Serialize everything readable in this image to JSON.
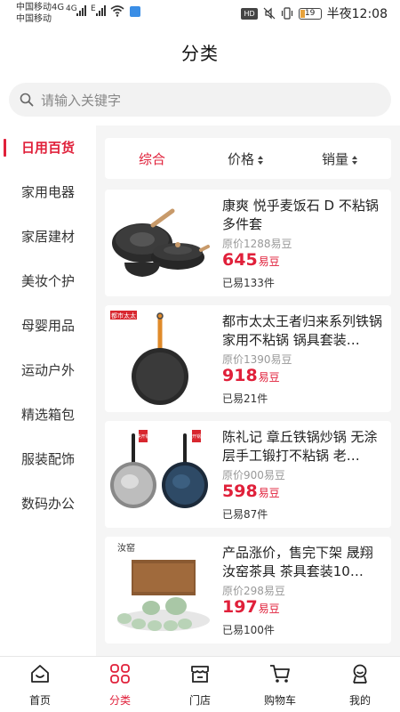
{
  "status_bar": {
    "carrier1": "中国移动4G",
    "carrier2": "中国移动",
    "net1": "4G",
    "net2": "E",
    "hd": "HD",
    "battery": "19",
    "time": "半夜12:08"
  },
  "header": {
    "title": "分类"
  },
  "search": {
    "placeholder": "请输入关键字"
  },
  "sidebar": {
    "items": [
      {
        "label": "日用百货",
        "active": true
      },
      {
        "label": "家用电器"
      },
      {
        "label": "家居建材"
      },
      {
        "label": "美妆个护"
      },
      {
        "label": "母婴用品"
      },
      {
        "label": "运动户外"
      },
      {
        "label": "精选箱包"
      },
      {
        "label": "服装配饰"
      },
      {
        "label": "数码办公"
      }
    ]
  },
  "filters": {
    "comprehensive": "综合",
    "price": "价格",
    "sales": "销量"
  },
  "products": [
    {
      "title": "康爽 悦乎麦饭石 D 不粘锅多件套",
      "original": "原价1288易豆",
      "price": "645",
      "unit": "易豆",
      "sold": "已易133件"
    },
    {
      "title": "都市太太王者归来系列铁锅家用不粘锅 锅具套装…",
      "original": "原价1390易豆",
      "price": "918",
      "unit": "易豆",
      "sold": "已易21件",
      "thumb_tag": "都市太太"
    },
    {
      "title": "陈礼记 章丘铁锅炒锅 无涂层手工锻打不粘锅 老…",
      "original": "原价900易豆",
      "price": "598",
      "unit": "易豆",
      "sold": "已易87件",
      "thumb_tag_a": "美开锅",
      "thumb_tag_b": "开锅"
    },
    {
      "title": "产品涨价，售完下架 晟翔汝窑茶具 茶具套装10…",
      "original": "原价298易豆",
      "price": "197",
      "unit": "易豆",
      "sold": "已易100件",
      "thumb_tag": "汝窑"
    }
  ],
  "tabs": [
    {
      "label": "首页"
    },
    {
      "label": "分类",
      "active": true
    },
    {
      "label": "门店"
    },
    {
      "label": "购物车"
    },
    {
      "label": "我的"
    }
  ],
  "colors": {
    "accent": "#e0203a",
    "panel_bg": "#f5f5f5",
    "search_bg": "#f2f2f2"
  }
}
